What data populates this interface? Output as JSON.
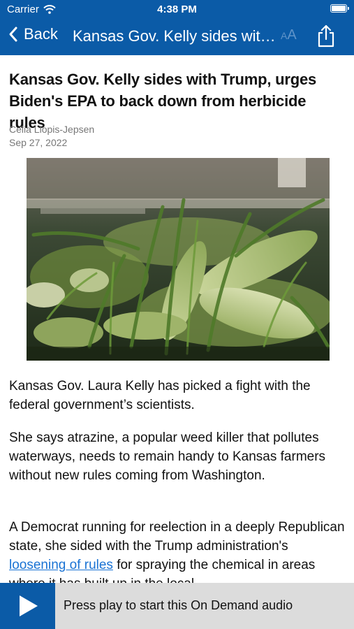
{
  "status_bar": {
    "carrier": "Carrier",
    "time": "4:38 PM"
  },
  "nav": {
    "back_label": "Back",
    "title": "Kansas Gov. Kelly sides wit…",
    "font_size_big": "A",
    "font_size_small": "A"
  },
  "article": {
    "headline": "Kansas Gov. Kelly sides with Trump, urges Biden's EPA to back down from herbicide rules",
    "author": "Celia Llopis-Jepsen",
    "date": "Sep 27, 2022",
    "image_icon": "corn-photo",
    "paragraphs": {
      "p1": "Kansas Gov. Laura Kelly has picked a fight with the federal government’s scientists.",
      "p2": "She says atrazine, a popular weed killer that pollutes waterways, needs to remain handy to Kansas farmers without new rules coming from Washington.",
      "p3_before": "A Democrat running for reelection in a deeply Republican state, she sided with the Trump administration's ",
      "p3_link": "loosening of rules",
      "p3_after": " for spraying the chemical in areas where it has built up in the local"
    }
  },
  "player": {
    "text": "Press play to start this On Demand audio"
  },
  "colors": {
    "brand_blue": "#0b5ba7",
    "link": "#1a73d4",
    "player_bg": "#dcdcdc"
  }
}
